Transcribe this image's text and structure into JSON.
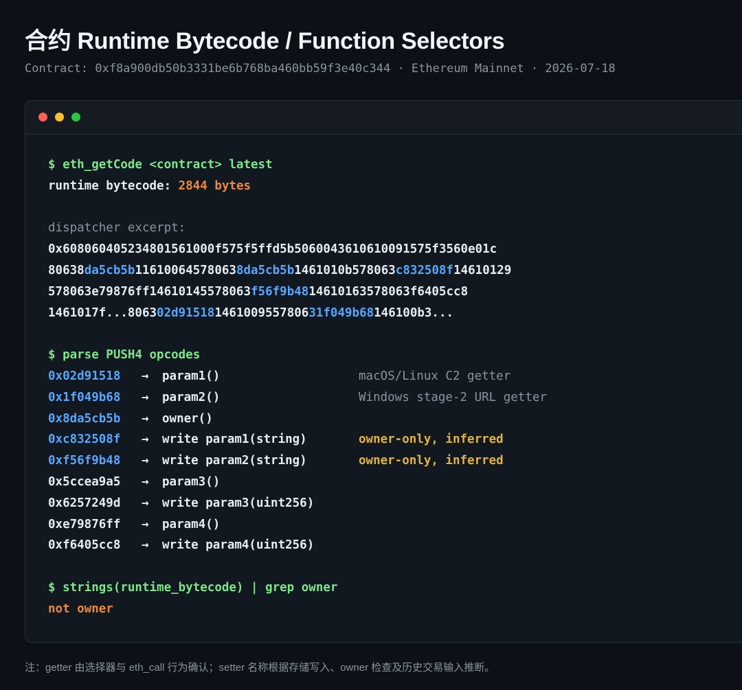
{
  "title": "合约 Runtime Bytecode / Function Selectors",
  "subtitle": "Contract: 0xf8a900db50b3331be6b768ba460bb59f3e40c344 · Ethereum Mainnet · 2026-07-18",
  "colors": {
    "background": "#0d1117",
    "command": "#7ee787",
    "selector_highlight": "#58a6ff",
    "value_orange": "#f0883e",
    "warning_yellow": "#e3b341",
    "muted": "#8b949e"
  },
  "terminal": {
    "window_controls": [
      "close-dot",
      "minimize-dot",
      "maximize-dot"
    ],
    "cmd1": "$ eth_getCode <contract> latest",
    "bytecode_label": "runtime bytecode: ",
    "bytecode_size": "2844 bytes",
    "dispatcher_label": "dispatcher excerpt:",
    "hex_lines": [
      [
        {
          "t": "0x608060405234801561000f575f5ffd5b5060043610610091575f3560e01c",
          "h": false
        }
      ],
      [
        {
          "t": "80638",
          "h": false
        },
        {
          "t": "da5cb5b",
          "h": true
        },
        {
          "t": "11610064578063",
          "h": false
        },
        {
          "t": "8da5cb5b",
          "h": true
        },
        {
          "t": "1461010b578063",
          "h": false
        },
        {
          "t": "c832508f",
          "h": true
        },
        {
          "t": "14610129",
          "h": false
        }
      ],
      [
        {
          "t": "578063e79876ff14610145578063",
          "h": false
        },
        {
          "t": "f56f9b48",
          "h": true
        },
        {
          "t": "14610163578063f6405cc8",
          "h": false
        }
      ],
      [
        {
          "t": "1461017f...8063",
          "h": false
        },
        {
          "t": "02d91518",
          "h": true
        },
        {
          "t": "1461009557806",
          "h": false
        },
        {
          "t": "31f049b68",
          "h": true
        },
        {
          "t": "146100b3...",
          "h": false
        }
      ]
    ],
    "cmd2": "$ parse PUSH4 opcodes",
    "selectors": [
      {
        "selector": "0x02d91518",
        "highlight": true,
        "arrow": "→",
        "fn": "param1()",
        "note": "macOS/Linux C2 getter",
        "note_style": "dim"
      },
      {
        "selector": "0x1f049b68",
        "highlight": true,
        "arrow": "→",
        "fn": "param2()",
        "note": "Windows stage-2 URL getter",
        "note_style": "dim"
      },
      {
        "selector": "0x8da5cb5b",
        "highlight": true,
        "arrow": "→",
        "fn": "owner()",
        "note": "",
        "note_style": "dim"
      },
      {
        "selector": "0xc832508f",
        "highlight": true,
        "arrow": "→",
        "fn": "write param1(string)",
        "note": "owner-only, inferred",
        "note_style": "warn"
      },
      {
        "selector": "0xf56f9b48",
        "highlight": true,
        "arrow": "→",
        "fn": "write param2(string)",
        "note": "owner-only, inferred",
        "note_style": "warn"
      },
      {
        "selector": "0x5ccea9a5",
        "highlight": false,
        "arrow": "→",
        "fn": "param3()",
        "note": "",
        "note_style": "dim"
      },
      {
        "selector": "0x6257249d",
        "highlight": false,
        "arrow": "→",
        "fn": "write param3(uint256)",
        "note": "",
        "note_style": "dim"
      },
      {
        "selector": "0xe79876ff",
        "highlight": false,
        "arrow": "→",
        "fn": "param4()",
        "note": "",
        "note_style": "dim"
      },
      {
        "selector": "0xf6405cc8",
        "highlight": false,
        "arrow": "→",
        "fn": "write param4(uint256)",
        "note": "",
        "note_style": "dim"
      }
    ],
    "cmd3": "$ strings(runtime_bytecode) | grep owner",
    "grep_result": "not owner"
  },
  "footer": "注：getter 由选择器与 eth_call 行为确认；setter 名称根据存储写入、owner 检查及历史交易输入推断。"
}
